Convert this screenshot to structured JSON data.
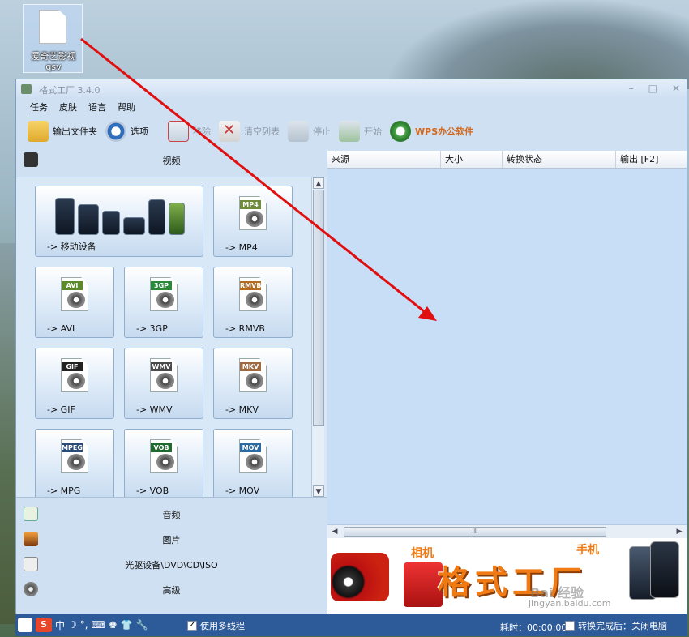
{
  "desktop": {
    "icon_label_line1": "爱奇艺影视",
    "icon_label_line2": "qsv"
  },
  "window": {
    "title": "格式工厂 3.4.0",
    "controls": [
      "–",
      "□",
      "✕"
    ]
  },
  "menu": [
    "任务",
    "皮肤",
    "语言",
    "帮助"
  ],
  "toolbar": {
    "output_folder": "输出文件夹",
    "options": "选项",
    "remove": "移除",
    "clear_list": "清空列表",
    "stop": "停止",
    "start": "开始",
    "wps": "WPS办公软件"
  },
  "categories": {
    "video": "视频",
    "audio": "音频",
    "image": "图片",
    "disc": "光驱设备\\DVD\\CD\\ISO",
    "advanced": "高级"
  },
  "tiles": [
    {
      "label": "-> 移动设备",
      "tag": ""
    },
    {
      "label": "-> MP4",
      "tag": "MP4",
      "color": "#6d8b3a"
    },
    {
      "label": "-> AVI",
      "tag": "AVI",
      "color": "#5a8a2a"
    },
    {
      "label": "-> 3GP",
      "tag": "3GP",
      "color": "#2b8a3a"
    },
    {
      "label": "-> RMVB",
      "tag": "RMVB",
      "color": "#b36b1d"
    },
    {
      "label": "-> GIF",
      "tag": "GIF",
      "color": "#222222"
    },
    {
      "label": "-> WMV",
      "tag": "WMV",
      "color": "#4a4a4a"
    },
    {
      "label": "-> MKV",
      "tag": "MKV",
      "color": "#a06a40"
    },
    {
      "label": "-> MPG",
      "tag": "MPEG",
      "color": "#2a4a7a"
    },
    {
      "label": "-> VOB",
      "tag": "VOB",
      "color": "#1f6a2f"
    },
    {
      "label": "-> MOV",
      "tag": "MOV",
      "color": "#2a6aa0"
    }
  ],
  "list_headers": [
    "来源",
    "大小",
    "转换状态",
    "输出 [F2]"
  ],
  "hscroll_grip": "III",
  "banner": {
    "title": "格式工厂",
    "sub_left": "相机",
    "sub_right": "手机",
    "watermark": "Bai 经验",
    "watermark_url": "jingyan.baidu.com"
  },
  "statusbar": {
    "ime": [
      "中",
      "☽",
      "°,",
      "⌨",
      "♚",
      "👕",
      "🔧"
    ],
    "multithread_label": "使用多线程",
    "multithread_checked": true,
    "elapsed": "耗时：00:00:00",
    "after_label": "转换完成后：关闭电脑",
    "after_checked": false
  }
}
